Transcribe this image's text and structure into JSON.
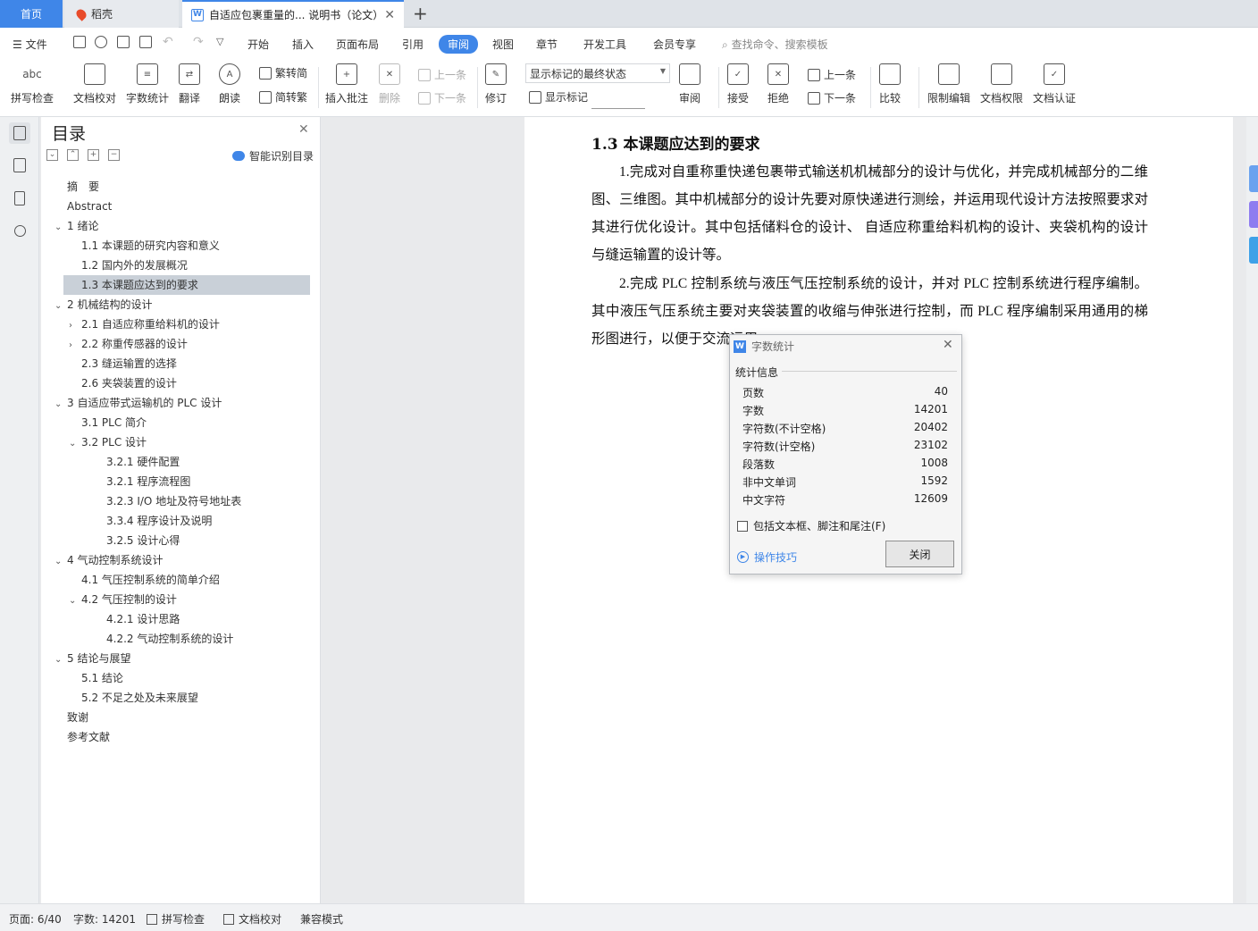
{
  "tabs": {
    "home": "首页",
    "daoke": "稻壳",
    "doc": "自适应包裹重量的... 说明书（论文）"
  },
  "menu": {
    "file": "文件",
    "items": [
      "开始",
      "插入",
      "页面布局",
      "引用",
      "审阅",
      "视图",
      "章节",
      "开发工具",
      "会员专享"
    ],
    "active": "审阅",
    "search_placeholder": "查找命令、搜索模板"
  },
  "ribbon": {
    "spell": "拼写检查",
    "proofread": "文档校对",
    "wordcount": "字数统计",
    "translate": "翻译",
    "read": "朗读",
    "trad": "繁转简",
    "simp": "简转繁",
    "comment": "插入批注",
    "delete": "删除",
    "prev": "上一条",
    "next": "下一条",
    "revise": "修订",
    "markup_state": "显示标记的最终状态",
    "show_markup": "显示标记",
    "review": "审阅",
    "accept": "接受",
    "reject": "拒绝",
    "prev2": "上一条",
    "next2": "下一条",
    "compare": "比较",
    "restrict": "限制编辑",
    "rights": "文档权限",
    "certify": "文档认证"
  },
  "toc": {
    "title": "目录",
    "ai_label": "智能识别目录",
    "items": [
      {
        "label": "摘　要",
        "indent": 0,
        "caret": ""
      },
      {
        "label": "Abstract",
        "indent": 0,
        "caret": ""
      },
      {
        "label": "1  绪论",
        "indent": 0,
        "caret": "v"
      },
      {
        "label": "1.1  本课题的研究内容和意义",
        "indent": 1,
        "caret": ""
      },
      {
        "label": "1.2  国内外的发展概况",
        "indent": 1,
        "caret": ""
      },
      {
        "label": "1.3  本课题应达到的要求",
        "indent": 1,
        "caret": ""
      },
      {
        "label": "2  机械结构的设计",
        "indent": 0,
        "caret": "v"
      },
      {
        "label": "2.1  自适应称重给料机的设计",
        "indent": 1,
        "caret": ">"
      },
      {
        "label": "2.2  称重传感器的设计",
        "indent": 1,
        "caret": ">"
      },
      {
        "label": "2.3  缝运输置的选择",
        "indent": 1,
        "caret": ""
      },
      {
        "label": "2.6  夹袋装置的设计",
        "indent": 1,
        "caret": ""
      },
      {
        "label": "3  自适应带式运输机的 PLC 设计",
        "indent": 0,
        "caret": "v"
      },
      {
        "label": "3.1 PLC 简介",
        "indent": 1,
        "caret": ""
      },
      {
        "label": "3.2 PLC 设计",
        "indent": 1,
        "caret": "v"
      },
      {
        "label": "3.2.1  硬件配置",
        "indent": 2,
        "caret": ""
      },
      {
        "label": "3.2.1  程序流程图",
        "indent": 2,
        "caret": ""
      },
      {
        "label": "3.2.3 I/O 地址及符号地址表",
        "indent": 2,
        "caret": ""
      },
      {
        "label": "3.3.4  程序设计及说明",
        "indent": 2,
        "caret": ""
      },
      {
        "label": "3.2.5  设计心得",
        "indent": 2,
        "caret": ""
      },
      {
        "label": "4  气动控制系统设计",
        "indent": 0,
        "caret": "v"
      },
      {
        "label": "4.1  气压控制系统的简单介绍",
        "indent": 1,
        "caret": ""
      },
      {
        "label": "4.2  气压控制的设计",
        "indent": 1,
        "caret": "v"
      },
      {
        "label": "4.2.1  设计思路",
        "indent": 2,
        "caret": ""
      },
      {
        "label": "4.2.2  气动控制系统的设计",
        "indent": 2,
        "caret": ""
      },
      {
        "label": "5  结论与展望",
        "indent": 0,
        "caret": "v"
      },
      {
        "label": "5.1  结论",
        "indent": 1,
        "caret": ""
      },
      {
        "label": "5.2  不足之处及未来展望",
        "indent": 1,
        "caret": ""
      },
      {
        "label": "致谢",
        "indent": 0,
        "caret": ""
      },
      {
        "label": "参考文献",
        "indent": 0,
        "caret": ""
      }
    ],
    "selected_index": 5
  },
  "doc": {
    "heading": "1.3  本课题应达到的要求",
    "para1": "1.完成对自重称重快递包裹带式输送机机械部分的设计与优化，并完成机械部分的二维图、三维图。其中机械部分的设计先要对原快递进行测绘，并运用现代设计方法按照要求对其进行优化设计。其中包括储料仓的设计、 自适应称重给料机构的设计、夹袋机构的设计与缝运输置的设计等。",
    "para2": "2.完成 PLC 控制系统与液压气压控制系统的设计，并对 PLC 控制系统进行程序编制。其中液压气压系统主要对夹袋装置的收缩与伸张进行控制，而 PLC 程序编制采用通用的梯形图进行，以便于交流运用。"
  },
  "dialog": {
    "title": "字数统计",
    "group": "统计信息",
    "stats": [
      {
        "label": "页数",
        "value": "40"
      },
      {
        "label": "字数",
        "value": "14201"
      },
      {
        "label": "字符数(不计空格)",
        "value": "20402"
      },
      {
        "label": "字符数(计空格)",
        "value": "23102"
      },
      {
        "label": "段落数",
        "value": "1008"
      },
      {
        "label": "非中文单词",
        "value": "1592"
      },
      {
        "label": "中文字符",
        "value": "12609"
      }
    ],
    "checkbox": "包括文本框、脚注和尾注(F)",
    "tips": "操作技巧",
    "close": "关闭"
  },
  "status": {
    "page": "页面: 6/40",
    "words": "字数: 14201",
    "spell": "拼写检查",
    "proof": "文档校对",
    "compat": "兼容模式"
  },
  "colors": {
    "accent": "#3f86e8",
    "toc_selected": "#c9d0d8"
  }
}
